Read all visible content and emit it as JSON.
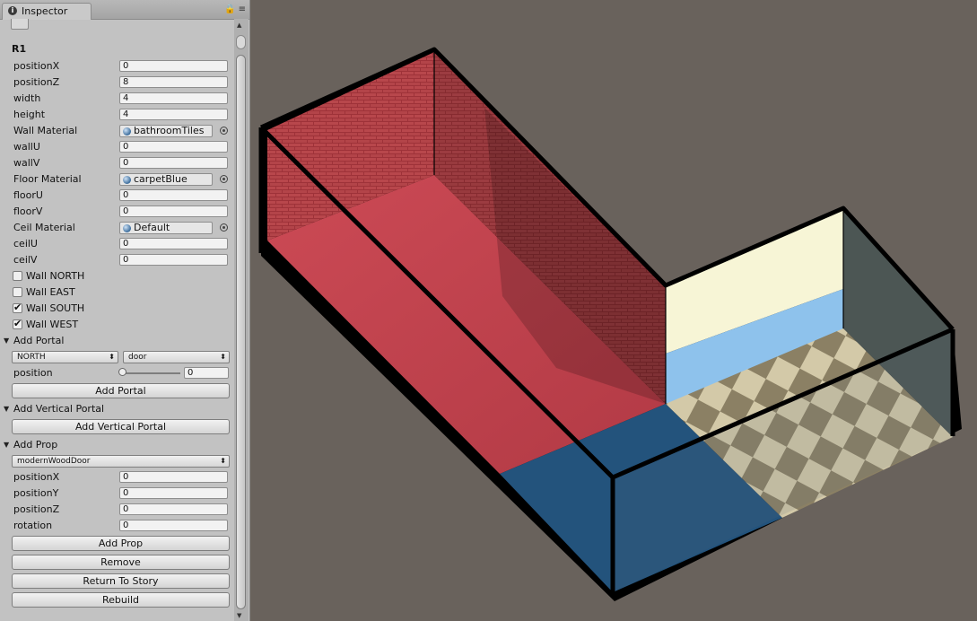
{
  "inspector": {
    "tab_title": "Inspector",
    "object_name": "R1",
    "fields": [
      {
        "label": "positionX",
        "value": "0"
      },
      {
        "label": "positionZ",
        "value": "8"
      },
      {
        "label": "width",
        "value": "4"
      },
      {
        "label": "height",
        "value": "4"
      }
    ],
    "wall_material": {
      "label": "Wall Material",
      "value": "bathroomTiles"
    },
    "wall_uv": [
      {
        "label": "wallU",
        "value": "0"
      },
      {
        "label": "wallV",
        "value": "0"
      }
    ],
    "floor_material": {
      "label": "Floor Material",
      "value": "carpetBlue"
    },
    "floor_uv": [
      {
        "label": "floorU",
        "value": "0"
      },
      {
        "label": "floorV",
        "value": "0"
      }
    ],
    "ceil_material": {
      "label": "Ceil Material",
      "value": "Default"
    },
    "ceil_uv": [
      {
        "label": "ceilU",
        "value": "0"
      },
      {
        "label": "ceilV",
        "value": "0"
      }
    ],
    "walls": [
      {
        "label": "Wall NORTH",
        "checked": false
      },
      {
        "label": "Wall EAST",
        "checked": false
      },
      {
        "label": "Wall SOUTH",
        "checked": true
      },
      {
        "label": "Wall WEST",
        "checked": true
      }
    ],
    "add_portal": {
      "title": "Add Portal",
      "direction": "NORTH",
      "type": "door",
      "position_label": "position",
      "position_value": "0",
      "position_fraction": 0,
      "button": "Add Portal"
    },
    "add_vertical_portal": {
      "title": "Add Vertical Portal",
      "button": "Add Vertical Portal"
    },
    "add_prop": {
      "title": "Add Prop",
      "prop": "modernWoodDoor",
      "fields": [
        {
          "label": "positionX",
          "value": "0"
        },
        {
          "label": "positionY",
          "value": "0"
        },
        {
          "label": "positionZ",
          "value": "0"
        },
        {
          "label": "rotation",
          "value": "0"
        }
      ],
      "button": "Add Prop"
    },
    "buttons": {
      "remove": "Remove",
      "return": "Return To Story",
      "rebuild": "Rebuild"
    }
  },
  "colors": {
    "scene_background": "#69625c",
    "brick_wall": "#a33a40",
    "red_carpet": "#c74650",
    "blue_carpet": "#23537c",
    "cream_wall": "#f7f5d6",
    "light_blue_wall": "#8ec2ec",
    "checker_light": "#cdc2a2",
    "checker_dark": "#8a7e63"
  }
}
